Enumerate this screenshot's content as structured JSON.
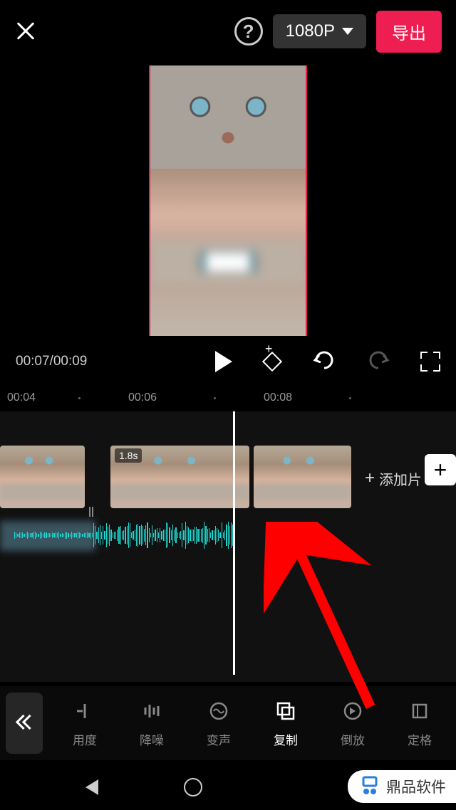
{
  "header": {
    "resolution_label": "1080P",
    "export_label": "导出"
  },
  "playback": {
    "current_time": "00:07",
    "total_time": "00:09"
  },
  "ruler": {
    "marks": [
      "00:04",
      "00:06",
      "00:08"
    ]
  },
  "timeline": {
    "clip2_duration": "1.8s",
    "add_clip_label": "添加片"
  },
  "toolbar": {
    "items": [
      {
        "label": "用度",
        "icon": "speed"
      },
      {
        "label": "降噪",
        "icon": "noise"
      },
      {
        "label": "变声",
        "icon": "voice"
      },
      {
        "label": "复制",
        "icon": "copy"
      },
      {
        "label": "倒放",
        "icon": "reverse"
      },
      {
        "label": "定格",
        "icon": "freeze"
      }
    ]
  },
  "watermark": {
    "text": "鼎品软件"
  }
}
